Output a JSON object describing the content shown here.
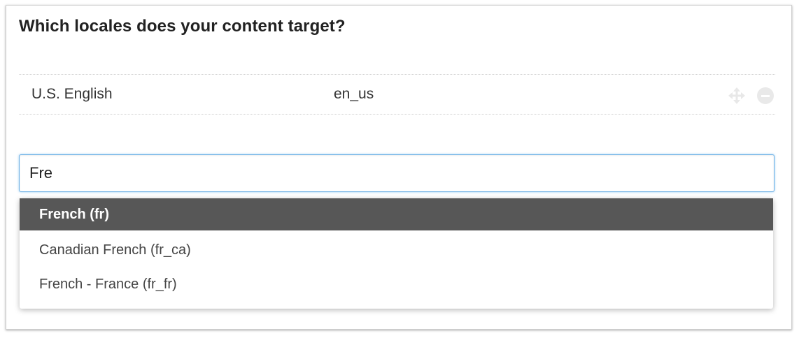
{
  "question": {
    "title": "Which locales does your content target?"
  },
  "locales": [
    {
      "name": "U.S. English",
      "code": "en_us",
      "move_icon": "move-arrows-icon",
      "remove_icon": "minus-circle-icon"
    }
  ],
  "search": {
    "value": "Fre",
    "placeholder": ""
  },
  "suggestions": [
    {
      "label": "French (fr)",
      "highlighted": true
    },
    {
      "label": "Canadian French (fr_ca)",
      "highlighted": false
    },
    {
      "label": "French - France (fr_fr)",
      "highlighted": false
    }
  ],
  "colors": {
    "highlight_background": "#575757",
    "focus_border": "#6fb2e6",
    "icon_gray": "#e9e9e9"
  }
}
